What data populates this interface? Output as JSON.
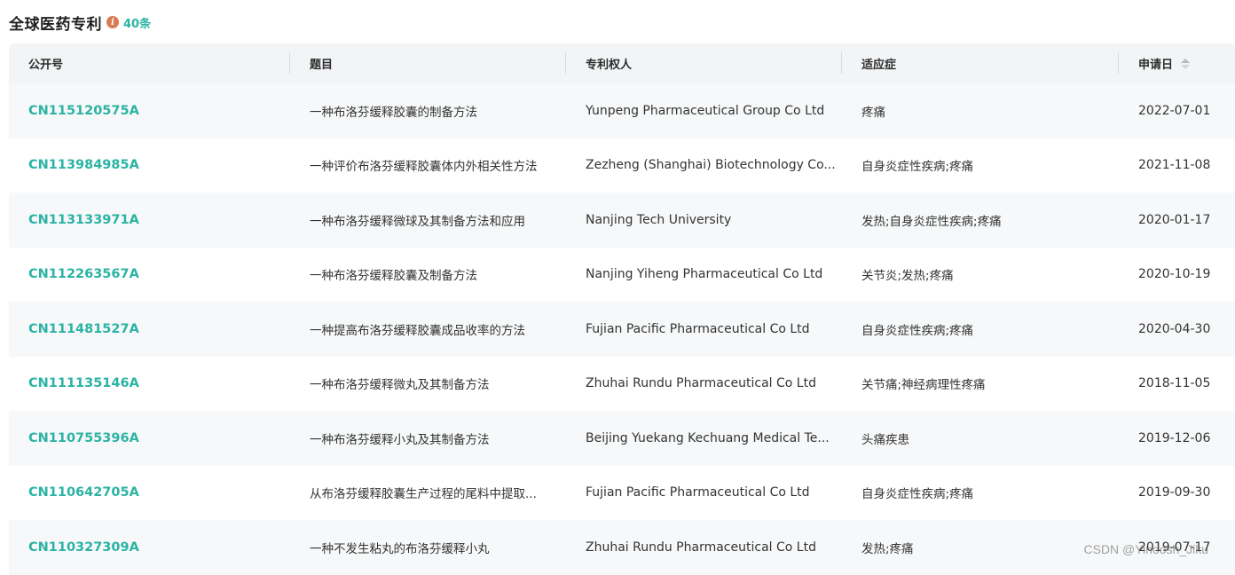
{
  "header": {
    "title": "全球医药专利",
    "info_icon": "info-icon",
    "count": "40条"
  },
  "columns": {
    "pub_no": "公开号",
    "title": "题目",
    "owner": "专利权人",
    "indication": "适应症",
    "date": "申请日"
  },
  "rows": [
    {
      "pub_no": "CN115120575A",
      "title": "一种布洛芬缓释胶囊的制备方法",
      "owner": "Yunpeng Pharmaceutical Group Co Ltd",
      "indication": "疼痛",
      "date": "2022-07-01"
    },
    {
      "pub_no": "CN113984985A",
      "title": "一种评价布洛芬缓释胶囊体内外相关性方法",
      "owner": "Zezheng (Shanghai) Biotechnology Co...",
      "indication": "自身炎症性疾病;疼痛",
      "date": "2021-11-08"
    },
    {
      "pub_no": "CN113133971A",
      "title": "一种布洛芬缓释微球及其制备方法和应用",
      "owner": "Nanjing Tech University",
      "indication": "发热;自身炎症性疾病;疼痛",
      "date": "2020-01-17"
    },
    {
      "pub_no": "CN112263567A",
      "title": "一种布洛芬缓释胶囊及制备方法",
      "owner": "Nanjing Yiheng Pharmaceutical Co Ltd",
      "indication": "关节炎;发热;疼痛",
      "date": "2020-10-19"
    },
    {
      "pub_no": "CN111481527A",
      "title": "一种提高布洛芬缓释胶囊成品收率的方法",
      "owner": "Fujian Pacific Pharmaceutical Co Ltd",
      "indication": "自身炎症性疾病;疼痛",
      "date": "2020-04-30"
    },
    {
      "pub_no": "CN111135146A",
      "title": "一种布洛芬缓释微丸及其制备方法",
      "owner": "Zhuhai Rundu Pharmaceutical Co Ltd",
      "indication": "关节痛;神经病理性疼痛",
      "date": "2018-11-05"
    },
    {
      "pub_no": "CN110755396A",
      "title": "一种布洛芬缓释小丸及其制备方法",
      "owner": "Beijing Yuekang Kechuang Medical Te...",
      "indication": "头痛疾患",
      "date": "2019-12-06"
    },
    {
      "pub_no": "CN110642705A",
      "title": "从布洛芬缓释胶囊生产过程的尾料中提取...",
      "owner": "Fujian Pacific Pharmaceutical Co Ltd",
      "indication": "自身炎症性疾病;疼痛",
      "date": "2019-09-30"
    },
    {
      "pub_no": "CN110327309A",
      "title": "一种不发生粘丸的布洛芬缓释小丸",
      "owner": "Zhuhai Rundu Pharmaceutical Co Ltd",
      "indication": "发热;疼痛",
      "date": "2019-07-17"
    }
  ],
  "watermark": "CSDN @Yinoosh_Jiku",
  "colors": {
    "accent": "#2bb3a4",
    "info_icon": "#d97b54",
    "header_bg": "#f2f4f6",
    "stripe_bg": "#f7f8f9"
  }
}
